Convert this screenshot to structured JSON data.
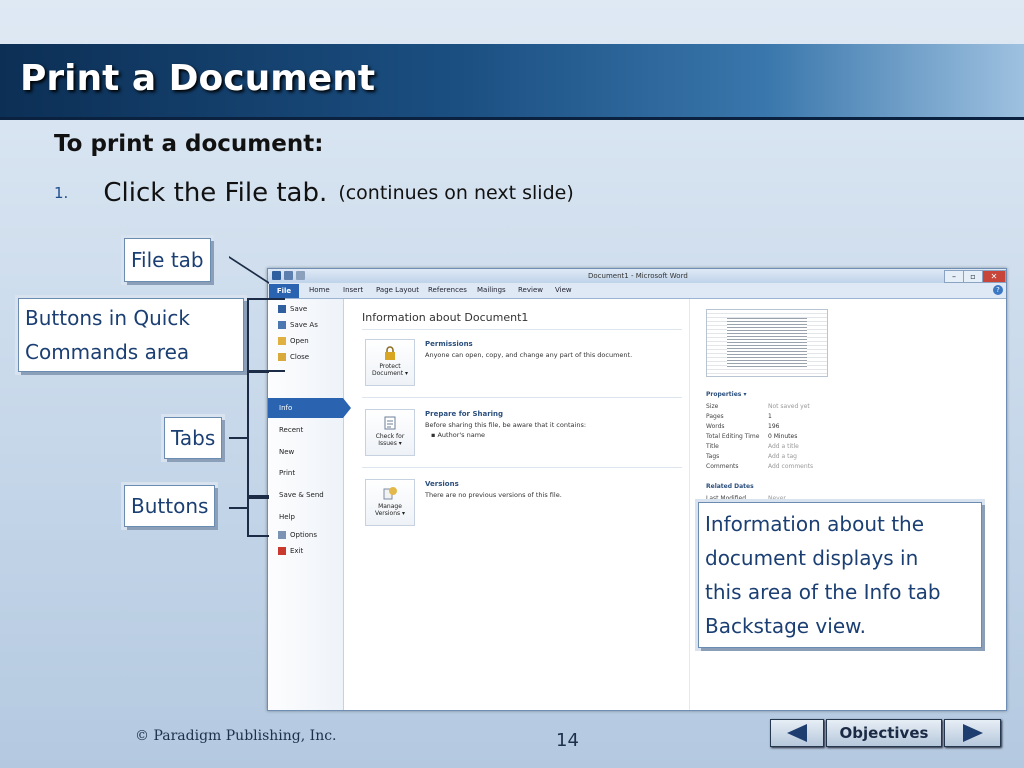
{
  "slide": {
    "title": "Print a Document",
    "heading": "To print a document:",
    "step": {
      "number": "1.",
      "text": "Click the File tab.",
      "note": "(continues on next slide)"
    }
  },
  "callouts": {
    "file_tab": "File tab",
    "quick_line1": "Buttons in Quick",
    "quick_line2": "Commands area",
    "tabs": "Tabs",
    "buttons": "Buttons",
    "info_lines": [
      "Information about the",
      "document displays in",
      "this area of the Info tab",
      "Backstage view."
    ]
  },
  "word": {
    "window_title": "Document1 - Microsoft Word",
    "ribbon_tabs": [
      "File",
      "Home",
      "Insert",
      "Page Layout",
      "References",
      "Mailings",
      "Review",
      "View"
    ],
    "quick_commands": [
      "Save",
      "Save As",
      "Open",
      "Close"
    ],
    "nav_tabs": [
      "Info",
      "Recent",
      "New",
      "Print",
      "Save & Send",
      "Help"
    ],
    "bottom_items": [
      "Options",
      "Exit"
    ],
    "info_heading": "Information about Document1",
    "sections": [
      {
        "button_line1": "Protect",
        "button_line2": "Document ▾",
        "heading": "Permissions",
        "text": "Anyone can open, copy, and change any part of this document.",
        "bullet": ""
      },
      {
        "button_line1": "Check for",
        "button_line2": "Issues ▾",
        "heading": "Prepare for Sharing",
        "text": "Before sharing this file, be aware that it contains:",
        "bullet": "Author's name"
      },
      {
        "button_line1": "Manage",
        "button_line2": "Versions ▾",
        "heading": "Versions",
        "text": "There are no previous versions of this file.",
        "bullet": ""
      }
    ],
    "properties_heading": "Properties ▾",
    "properties": [
      {
        "k": "Size",
        "v": "Not saved yet"
      },
      {
        "k": "Pages",
        "v": "1"
      },
      {
        "k": "Words",
        "v": "196"
      },
      {
        "k": "Total Editing Time",
        "v": "0 Minutes"
      },
      {
        "k": "Title",
        "v": "Add a title"
      },
      {
        "k": "Tags",
        "v": "Add a tag"
      },
      {
        "k": "Comments",
        "v": "Add comments"
      }
    ],
    "related_dates_heading": "Related Dates",
    "last_modified": {
      "k": "Last Modified",
      "v": "Never"
    }
  },
  "footer": {
    "copyright": "© Paradigm Publishing, Inc.",
    "page_number": "14",
    "objectives_label": "Objectives"
  }
}
